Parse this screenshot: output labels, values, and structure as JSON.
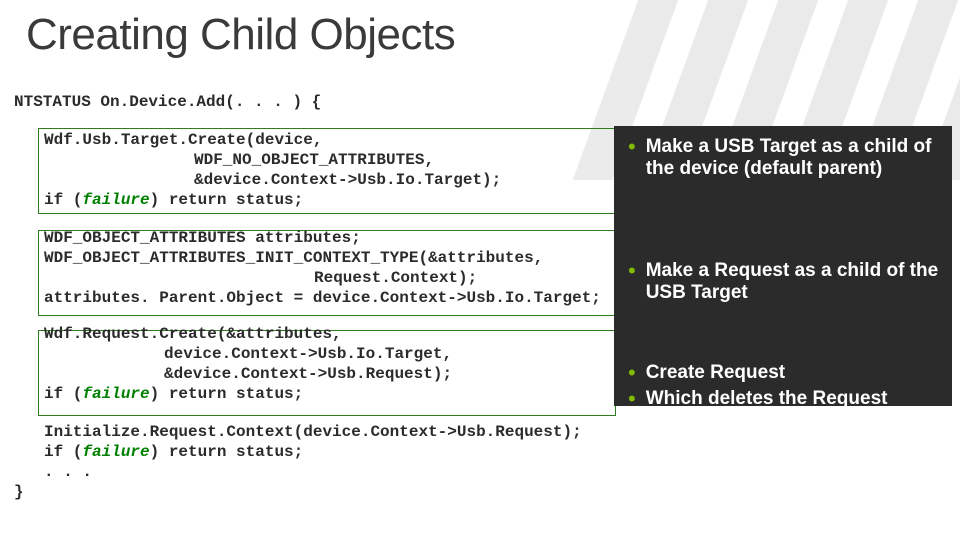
{
  "title": "Creating Child Objects",
  "code": {
    "sig": "NTSTATUS On.Device.Add(. . . ) {",
    "b1l1": "Wdf.Usb.Target.Create(device,",
    "b1l2": "WDF_NO_OBJECT_ATTRIBUTES,",
    "b1l3": "&device.Context->Usb.Io.Target);",
    "b1fail": "if (failure) return status;",
    "b2l1": "WDF_OBJECT_ATTRIBUTES attributes;",
    "b2l2": "WDF_OBJECT_ATTRIBUTES_INIT_CONTEXT_TYPE(&attributes,",
    "b2l3": "Request.Context);",
    "b2l4": "attributes. Parent.Object = device.Context->Usb.Io.Target;",
    "b3l1": "Wdf.Request.Create(&attributes,",
    "b3l2": "device.Context->Usb.Io.Target,",
    "b3l3": "&device.Context->Usb.Request);",
    "b3fail": "if (failure) return status;",
    "b4l1": "Initialize.Request.Context(device.Context->Usb.Request);",
    "b4fail": "if (failure) return status;",
    "ell": ". . .",
    "close": "}"
  },
  "bullets": {
    "b1": "Make a USB Target as a child of the device (default parent)",
    "b2": "Make a Request as a child of the USB Target",
    "b3": "Create Request",
    "b4": "Which deletes the Request"
  },
  "dot": "•"
}
